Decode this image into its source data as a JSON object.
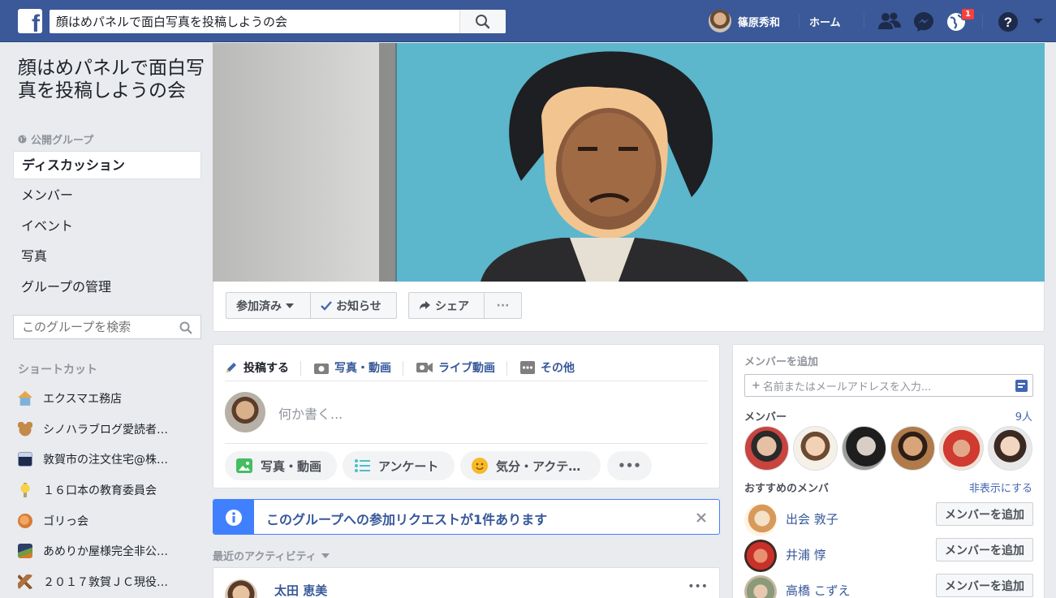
{
  "topbar": {
    "search_value": "顔はめパネルで面白写真を投稿しようの会",
    "user_name": "篠原秀和",
    "home_label": "ホーム",
    "notification_count": "1",
    "bar_color": "#3b5998"
  },
  "group": {
    "title": "顔はめパネルで面白写真を投稿しようの会",
    "privacy": "公開グループ"
  },
  "left_nav": {
    "items": [
      "ディスカッション",
      "メンバー",
      "イベント",
      "写真",
      "グループの管理"
    ],
    "search_placeholder": "このグループを検索"
  },
  "shortcuts": {
    "heading": "ショートカット",
    "items": [
      {
        "label": "エクスマエ務店",
        "icon": "house-icon"
      },
      {
        "label": "シノハラブログ愛読者…",
        "icon": "bear-icon"
      },
      {
        "label": "敦賀市の注文住宅@株…",
        "icon": "person-photo-icon"
      },
      {
        "label": "１６口本の教育委員会",
        "icon": "lightbulb-icon"
      },
      {
        "label": "ゴリっ会",
        "icon": "gorilla-icon"
      },
      {
        "label": "あめりか屋様完全非公…",
        "icon": "landscape-icon"
      },
      {
        "label": "２０１７敦賀ＪＣ現役…",
        "icon": "gavel-icon"
      }
    ]
  },
  "cover_actions": {
    "joined": "参加済み",
    "notifications": "お知らせ",
    "share": "シェア",
    "more": "···"
  },
  "composer": {
    "tabs": [
      "投稿する",
      "写真・動画",
      "ライブ動画",
      "その他"
    ],
    "placeholder": "何か書く...",
    "pills": [
      "写真・動画",
      "アンケート",
      "気分・アクテ…"
    ],
    "pill_more": "•••"
  },
  "notice": {
    "text": "このグループへの参加リクエストが1件あります",
    "color": "#4080ff"
  },
  "recent": {
    "heading": "最近のアクティビティ",
    "first_post_author": "太田 恵美",
    "post_more": "•••"
  },
  "right": {
    "add_member_title": "メンバーを追加",
    "add_member_placeholder": "名前またはメールアドレスを入力...",
    "members_title": "メンバー",
    "members_count": "9人",
    "suggested_title": "おすすめのメンバ",
    "hide_link": "非表示にする",
    "suggestions": [
      {
        "name": "出会 敦子",
        "button": "メンバーを追加"
      },
      {
        "name": "井浦 惇",
        "button": "メンバーを追加"
      },
      {
        "name": "高橋 こずえ",
        "button": "メンバーを追加"
      }
    ]
  }
}
